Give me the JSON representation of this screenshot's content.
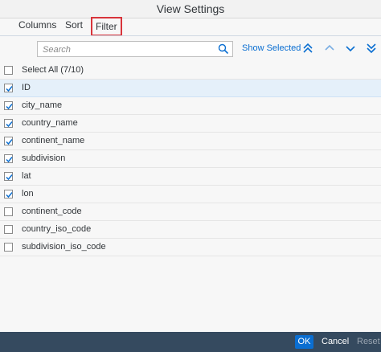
{
  "dialog": {
    "title": "View Settings"
  },
  "tabs": [
    {
      "label": "Columns"
    },
    {
      "label": "Sort"
    },
    {
      "label": "Filter",
      "highlighted": true,
      "highlight_color": "#d8343b"
    }
  ],
  "toolbar": {
    "search_placeholder": "Search",
    "search_value": "",
    "show_selected_label": "Show Selected",
    "icons": [
      "move-to-top-icon",
      "move-up-icon",
      "move-down-icon",
      "move-to-bottom-icon"
    ]
  },
  "list": {
    "select_all_label": "Select All (7/10)",
    "items": [
      {
        "label": "ID",
        "checked": true,
        "selected": true
      },
      {
        "label": "city_name",
        "checked": true
      },
      {
        "label": "country_name",
        "checked": true
      },
      {
        "label": "continent_name",
        "checked": true
      },
      {
        "label": "subdivision",
        "checked": true
      },
      {
        "label": "lat",
        "checked": true
      },
      {
        "label": "lon",
        "checked": true
      },
      {
        "label": "continent_code",
        "checked": false
      },
      {
        "label": "country_iso_code",
        "checked": false
      },
      {
        "label": "subdivision_iso_code",
        "checked": false
      }
    ]
  },
  "footer": {
    "ok_label": "OK",
    "cancel_label": "Cancel",
    "reset_label": "Reset"
  },
  "colors": {
    "accent": "#0a6ed1",
    "footer_bg": "#354a5f",
    "selected_row": "#e5f0fa"
  }
}
